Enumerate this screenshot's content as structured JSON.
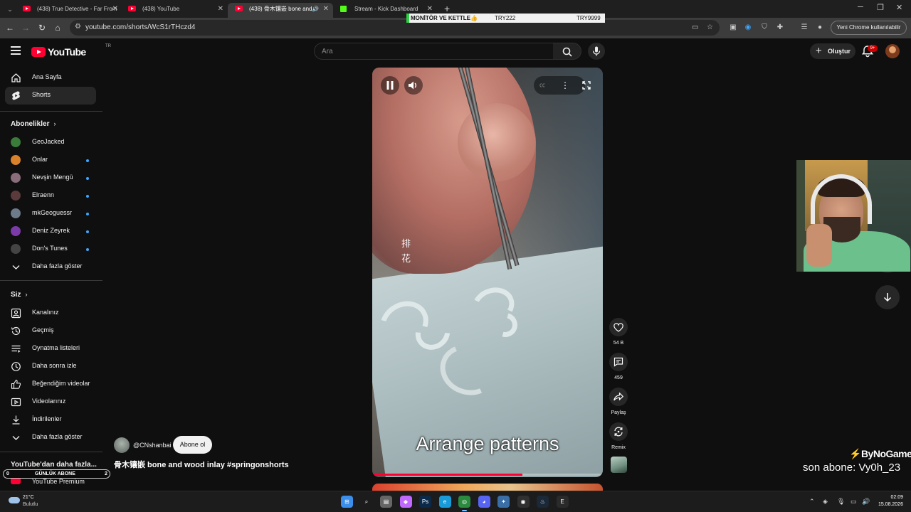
{
  "browser": {
    "tabs": [
      {
        "title": "(438) True Detective - Far From",
        "type": "youtube"
      },
      {
        "title": "(438) YouTube",
        "type": "youtube"
      },
      {
        "title": "(438) 骨木镶嵌 bone and w",
        "type": "youtube",
        "active": true
      },
      {
        "title": "Stream - Kick Dashboard",
        "type": "kick"
      }
    ],
    "url": "youtube.com/shorts/WcS1rTHczd4",
    "chrome_button": "Yeni Chrome kullanılabilir"
  },
  "stream_banner": {
    "label": "MONİTÖR VE KETTLE👍",
    "price1": "TRY222",
    "price2": "TRY9999"
  },
  "masthead": {
    "logo": "YouTube",
    "region": "TR",
    "search_placeholder": "Ara",
    "create_label": "Oluştur",
    "notifications": "9+"
  },
  "sidebar": {
    "main": [
      {
        "label": "Ana Sayfa",
        "icon": "home-icon"
      },
      {
        "label": "Shorts",
        "icon": "shorts-icon",
        "active": true
      }
    ],
    "subs_title": "Abonelikler",
    "subs": [
      {
        "label": "GeoJacked",
        "color": "#3a7d3a",
        "dot": false
      },
      {
        "label": "Onlar",
        "color": "#d9822b",
        "dot": true
      },
      {
        "label": "Nevşin Mengü",
        "color": "#8a6d7a",
        "dot": true
      },
      {
        "label": "Elraenn",
        "color": "#5a3a3a",
        "dot": true
      },
      {
        "label": "mkGeoguessr",
        "color": "#6c7a89",
        "dot": true
      },
      {
        "label": "Deniz Zeyrek",
        "color": "#7a3aa8",
        "dot": true
      },
      {
        "label": "Don's Tunes",
        "color": "#444444",
        "dot": true
      }
    ],
    "subs_more": "Daha fazla göster",
    "you_title": "Siz",
    "you": [
      {
        "label": "Kanalınız",
        "icon": "channel-icon"
      },
      {
        "label": "Geçmiş",
        "icon": "history-icon"
      },
      {
        "label": "Oynatma listeleri",
        "icon": "playlist-icon"
      },
      {
        "label": "Daha sonra izle",
        "icon": "watch-later-icon"
      },
      {
        "label": "Beğendiğim videolar",
        "icon": "like-icon"
      },
      {
        "label": "Videolarınız",
        "icon": "your-videos-icon"
      },
      {
        "label": "İndirilenler",
        "icon": "download-icon"
      }
    ],
    "you_more": "Daha fazla göster",
    "more_title": "YouTube'dan daha fazla...",
    "premium": "YouTube Premium"
  },
  "player": {
    "overlay_text": "排花",
    "caption": "Arrange patterns",
    "progress": 0.65
  },
  "actions": {
    "likes": "54 B",
    "comments": "459",
    "share": "Paylaş",
    "remix": "Remix"
  },
  "channel": {
    "handle": "@CNshanbai",
    "subscribe": "Abone ol",
    "title": "骨木镶嵌 bone and wood inlay #springonshorts"
  },
  "overlay": {
    "sub_goal_label": "GÜNLÜK ABONE",
    "sub_goal_current": "0",
    "sub_goal_target": "2",
    "brand": "ByNoGame",
    "last_sub": "son abone: Vy0h_23"
  },
  "taskbar": {
    "temp": "21°C",
    "condition": "Bulutlu",
    "time": "02:09",
    "date": "15.08.2026",
    "apps": [
      {
        "name": "windows-start-icon",
        "color": "#3b8eea"
      },
      {
        "name": "search-icon",
        "color": "transparent"
      },
      {
        "name": "task-view-icon",
        "color": "#666666"
      },
      {
        "name": "copilot-icon",
        "color": "#c069ff"
      },
      {
        "name": "photoshop-icon",
        "color": "#0b2a4a"
      },
      {
        "name": "edge-icon",
        "color": "#1a9bd9"
      },
      {
        "name": "chrome-icon",
        "color": "#2a8a3e"
      },
      {
        "name": "discord-icon",
        "color": "#5865f2"
      },
      {
        "name": "app-icon",
        "color": "#3a6ea5"
      },
      {
        "name": "obs-icon",
        "color": "#303030"
      },
      {
        "name": "steam-icon",
        "color": "#1b2838"
      },
      {
        "name": "epic-games-icon",
        "color": "#2a2a2a"
      }
    ]
  }
}
